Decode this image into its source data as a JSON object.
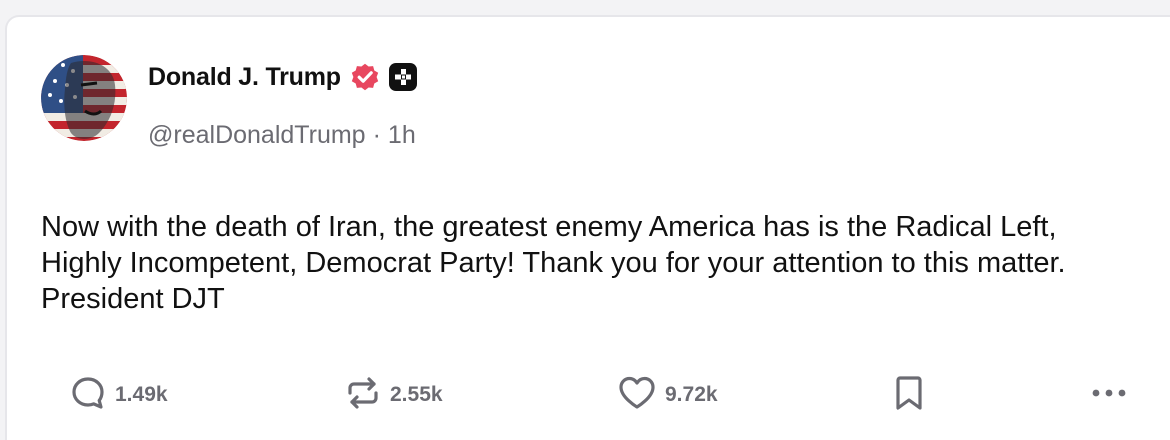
{
  "post": {
    "author": {
      "display_name": "Donald J. Trump",
      "handle": "@realDonaldTrump",
      "verified_badge_icon": "verified-check-icon",
      "platform_badge_icon": "truth-plus-icon"
    },
    "separator": "·",
    "time_ago": "1h",
    "text": "Now with the death of Iran, the greatest enemy America has is the Radical Left, Highly Incompetent, Democrat Party! Thank you for your attention to this matter. President DJT",
    "actions": {
      "replies": {
        "icon": "reply-icon",
        "count": "1.49k"
      },
      "retruths": {
        "icon": "retruth-icon",
        "count": "2.55k"
      },
      "likes": {
        "icon": "heart-icon",
        "count": "9.72k"
      },
      "bookmark": {
        "icon": "bookmark-icon"
      },
      "more": {
        "icon": "more-icon"
      }
    }
  },
  "colors": {
    "text": "#111111",
    "muted": "#6b6b72",
    "verified": "#e8475f",
    "card_border": "#e6e6ea"
  }
}
